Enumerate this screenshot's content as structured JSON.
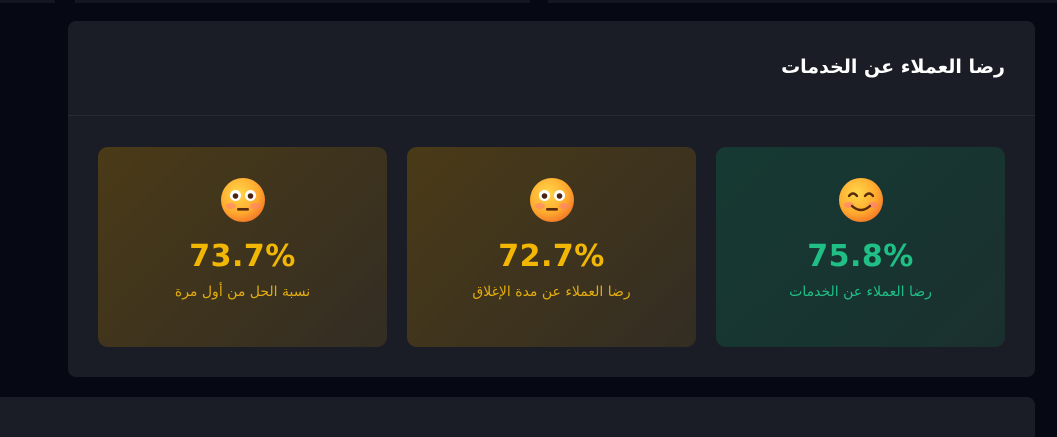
{
  "section": {
    "title": "رضا العملاء عن الخدمات"
  },
  "cards": [
    {
      "value": "75.8%",
      "label": "رضا العملاء عن الخدمات",
      "icon": "smiling-face-icon",
      "color": "#1fbf86"
    },
    {
      "value": "72.7%",
      "label": "رضا العملاء عن مدة الإغلاق",
      "icon": "neutral-face-icon",
      "color": "#f2b705"
    },
    {
      "value": "73.7%",
      "label": "نسبة الحل من أول مرة",
      "icon": "neutral-face-icon",
      "color": "#f2b705"
    }
  ]
}
